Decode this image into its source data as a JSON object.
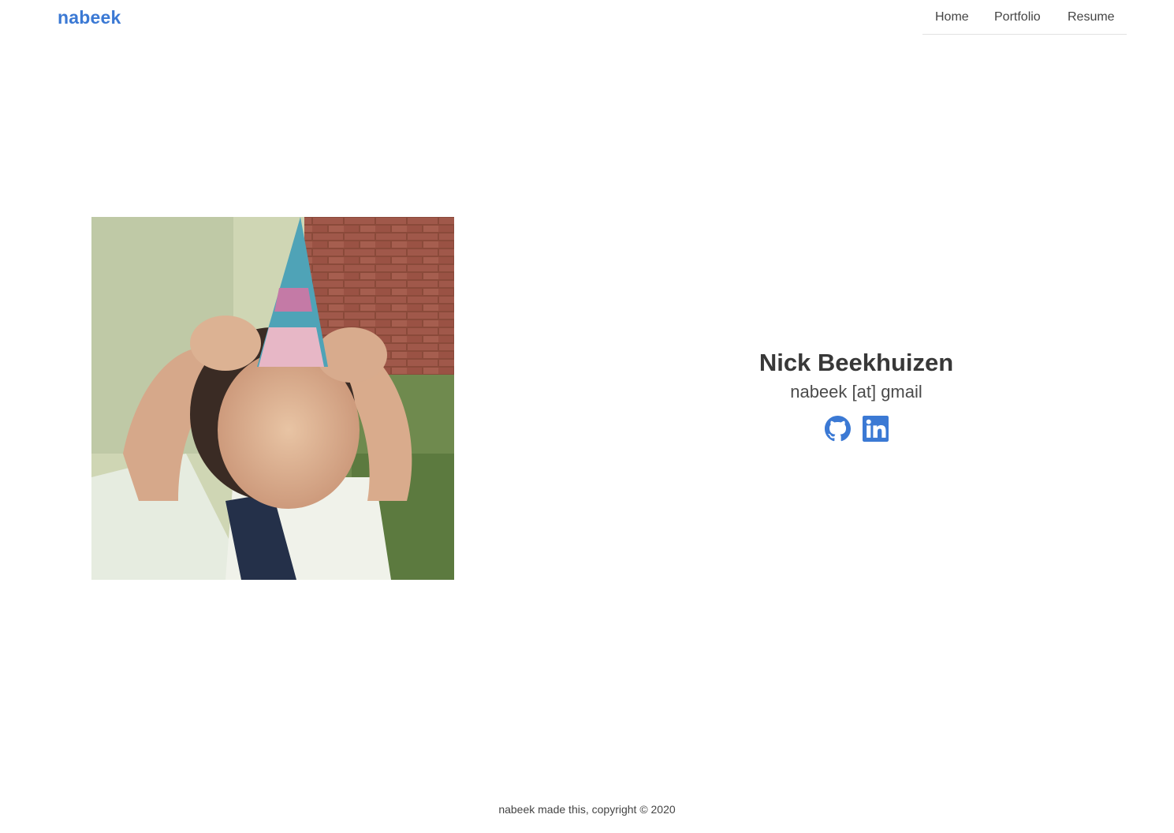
{
  "header": {
    "brand": "nabeek",
    "nav": [
      {
        "label": "Home"
      },
      {
        "label": "Portfolio"
      },
      {
        "label": "Resume"
      }
    ]
  },
  "profile": {
    "name": "Nick Beekhuizen",
    "email": "nabeek [at] gmail",
    "socials": [
      {
        "icon": "github-icon"
      },
      {
        "icon": "linkedin-icon"
      }
    ]
  },
  "footer": {
    "text": "nabeek made this, copyright © 2020"
  },
  "colors": {
    "accent": "#3b79d4",
    "text": "#3a3a3a",
    "background": "#ffffff"
  }
}
